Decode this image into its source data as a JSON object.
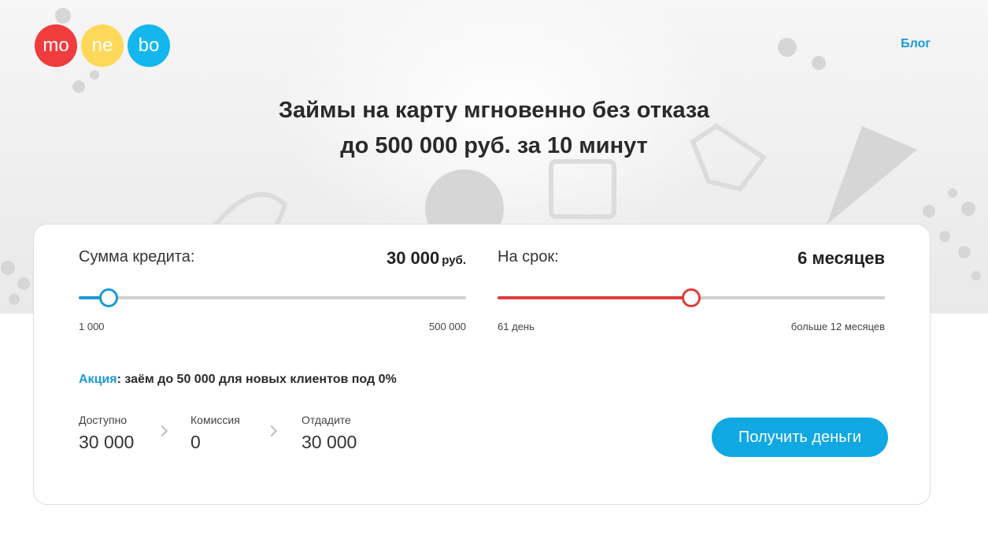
{
  "header": {
    "logo": [
      "mo",
      "ne",
      "bo"
    ],
    "blog_link": "Блог"
  },
  "hero": {
    "line1": "Займы на карту мгновенно без отказа",
    "line2": "до 500 000 руб. за 10 минут"
  },
  "calculator": {
    "amount": {
      "label": "Сумма кредита:",
      "value": "30 000",
      "unit": "руб.",
      "min_label": "1 000",
      "max_label": "500 000",
      "level": 0.078,
      "color": "#1a9ad6"
    },
    "term": {
      "label": "На срок:",
      "value": "6 месяцев",
      "min_label": "61 день",
      "max_label": "больше 12 месяцев",
      "level": 0.5,
      "color": "#e03c3c"
    },
    "promo": {
      "label": "Акция",
      "text": ": заём до 50 000 для новых клиентов под 0%"
    },
    "stats": {
      "available": {
        "label": "Доступно",
        "value": "30 000"
      },
      "commission": {
        "label": "Комиссия",
        "value": "0"
      },
      "return": {
        "label": "Отдадите",
        "value": "30 000"
      }
    },
    "cta_label": "Получить деньги"
  },
  "colors": {
    "accent": "#0fa8e3",
    "logo_red": "#f03c3c",
    "logo_yellow": "#ffd85a",
    "logo_blue": "#13b7ee"
  }
}
